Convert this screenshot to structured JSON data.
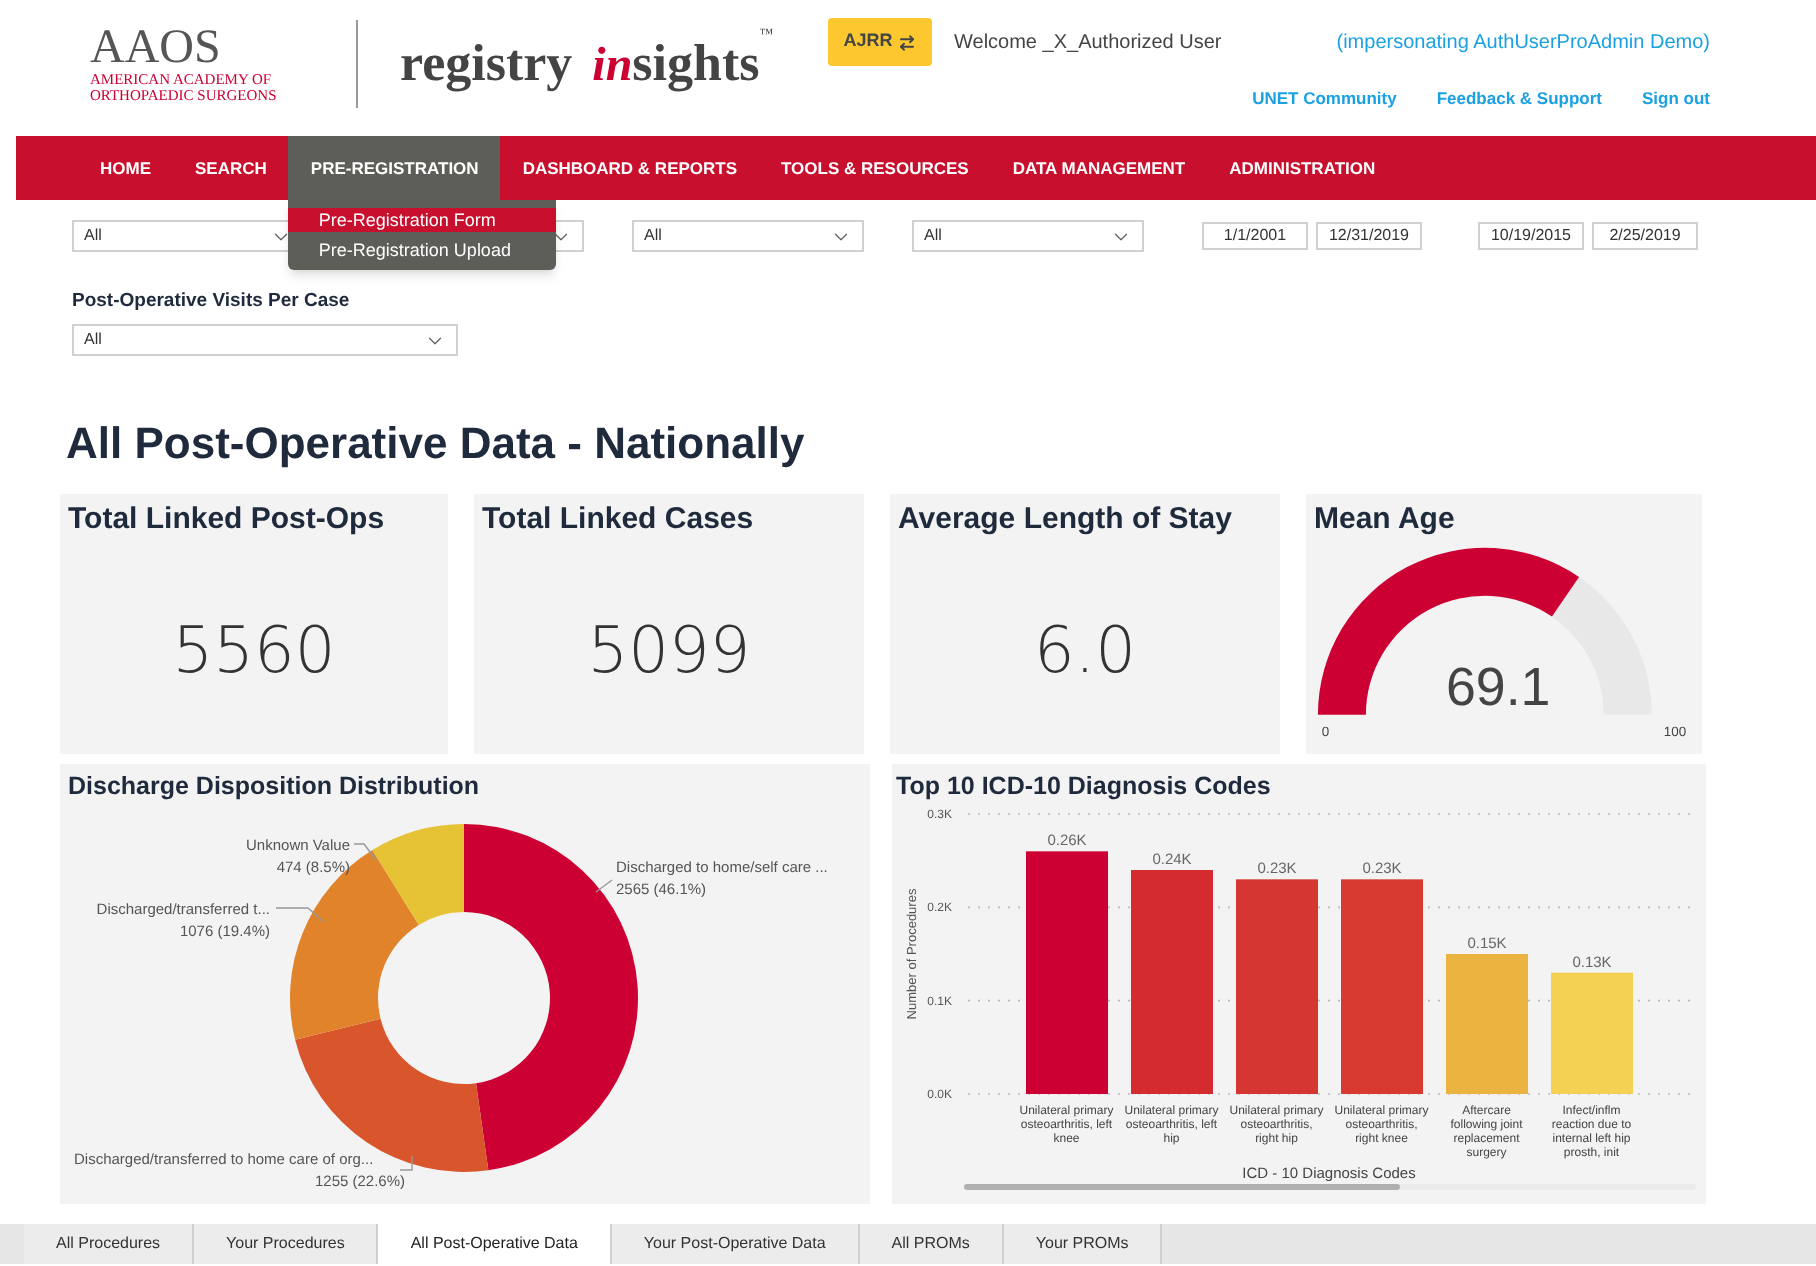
{
  "header": {
    "logo": {
      "acronym": "AAOS",
      "lines": [
        "AMERICAN ACADEMY OF",
        "ORTHOPAEDIC SURGEONS"
      ]
    },
    "product_logo": {
      "word_1": "registry",
      "script": "in",
      "word_2": "sights",
      "mark": "™"
    },
    "registry_button": {
      "label": "AJRR"
    },
    "welcome": "Welcome _X_Authorized User",
    "impersonation": "(impersonating AuthUserProAdmin Demo)",
    "links": [
      "UNET Community",
      "Feedback & Support",
      "Sign out"
    ]
  },
  "nav": {
    "items": [
      {
        "label": "HOME",
        "selected": false
      },
      {
        "label": "SEARCH",
        "selected": false
      },
      {
        "label": "PRE-REGISTRATION",
        "selected": true,
        "menu": [
          {
            "label": "Pre-Registration Form",
            "selected": true
          },
          {
            "label": "Pre-Registration Upload",
            "selected": false
          }
        ]
      },
      {
        "label": "DASHBOARD & REPORTS",
        "selected": false
      },
      {
        "label": "TOOLS & RESOURCES",
        "selected": false
      },
      {
        "label": "DATA MANAGEMENT",
        "selected": false
      },
      {
        "label": "ADMINISTRATION",
        "selected": false
      }
    ]
  },
  "filters": {
    "selects": [
      {
        "kind": "select",
        "value": "All"
      },
      {
        "kind": "select"
      },
      {
        "kind": "select",
        "value": "All"
      },
      {
        "kind": "select",
        "value": "All"
      }
    ],
    "date_ranges": [
      {
        "from": "1/1/2001",
        "to": "12/31/2019"
      },
      {
        "from": "10/19/2015",
        "to": "2/25/2019"
      }
    ]
  },
  "visits_filter": {
    "label": "Post-Operative Visits Per Case",
    "value": "All"
  },
  "page_title": "All Post-Operative Data - Nationally",
  "cards": [
    {
      "kind": "stat",
      "title": "Total Linked Post-Ops",
      "value": "5560"
    },
    {
      "kind": "stat",
      "title": "Total Linked Cases",
      "value": "5099"
    },
    {
      "kind": "stat",
      "title": "Average Length of Stay",
      "value": "6.0"
    },
    {
      "kind": "gauge",
      "title": "Mean Age",
      "value": "69.1",
      "level": 0.691,
      "min": "0",
      "max": "100"
    }
  ],
  "discharge_panel": {
    "chart_data": {
      "type": "donut",
      "title": "Discharge Disposition Distribution",
      "categories": [
        "Discharged to home/self care ...",
        "Discharged/transferred to home care of org...",
        "Discharged/transferred t...",
        "Unknown Value"
      ],
      "values": [
        2565,
        1255,
        1076,
        474
      ],
      "value_labels": [
        "2565 (46.1%)",
        "1255 (22.6%)",
        "1076 (19.4%)",
        "474 (8.5%)"
      ],
      "colors": [
        "#cc0033",
        "#d9552b",
        "#e0832b",
        "#e6c235"
      ]
    }
  },
  "diagnosis_panel": {
    "chart_data": {
      "type": "bar",
      "title": "Top 10 ICD-10 Diagnosis Codes",
      "xlabel": "ICD - 10 Diagnosis Codes",
      "ylabel": "Number of Procedures",
      "categories": [
        "Unilateral primary osteoarthritis, left knee",
        "Unilateral primary osteoarthritis, left hip",
        "Unilateral primary osteoarthritis, right hip",
        "Unilateral primary osteoarthritis, right knee",
        "Aftercare following joint replacement surgery",
        "Infect/inflm reaction due to internal left hip prosth, init"
      ],
      "values": [
        260,
        240,
        230,
        230,
        150,
        130
      ],
      "colors": [
        "#cc0033",
        "#d42b30",
        "#d63631",
        "#d83a31",
        "#ebb33f",
        "#f4d152"
      ],
      "ylim": [
        0,
        300
      ],
      "yticks": [
        {
          "value": 0,
          "label": "0.0K"
        },
        {
          "value": 100,
          "label": "0.1K"
        },
        {
          "value": 200,
          "label": "0.2K"
        },
        {
          "value": 300,
          "label": "0.3K"
        }
      ],
      "value_labels": [
        "0.26K",
        "0.24K",
        "0.23K",
        "0.23K",
        "0.15K",
        "0.13K"
      ]
    }
  },
  "tabs": [
    {
      "label": "All Procedures",
      "selected": false
    },
    {
      "label": "Your Procedures",
      "selected": false
    },
    {
      "label": "All Post-Operative Data",
      "selected": true
    },
    {
      "label": "Your Post-Operative Data",
      "selected": false
    },
    {
      "label": "All PROMs",
      "selected": false
    },
    {
      "label": "Your PROMs",
      "selected": false
    }
  ]
}
